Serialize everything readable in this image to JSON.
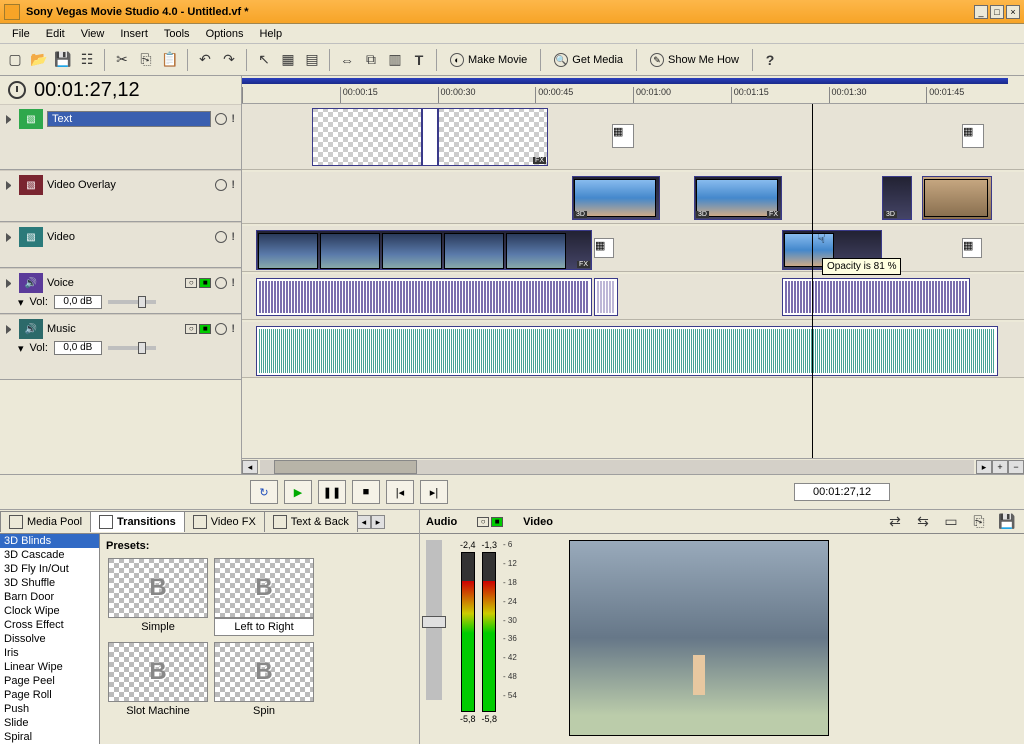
{
  "window": {
    "title": "Sony Vegas Movie Studio 4.0 - Untitled.vf *"
  },
  "menu": [
    "File",
    "Edit",
    "View",
    "Insert",
    "Tools",
    "Options",
    "Help"
  ],
  "toolbar": {
    "make_movie": "Make Movie",
    "get_media": "Get Media",
    "show_me_how": "Show Me How"
  },
  "timecode": "00:01:27,12",
  "tracks": [
    {
      "name": "Text",
      "color": "green",
      "selected": true
    },
    {
      "name": "Video Overlay",
      "color": "maroon"
    },
    {
      "name": "Video",
      "color": "teal"
    },
    {
      "name": "Voice",
      "color": "purple",
      "vol_label": "Vol:",
      "vol_value": "0,0 dB"
    },
    {
      "name": "Music",
      "color": "darkteal",
      "vol_label": "Vol:",
      "vol_value": "0,0 dB"
    }
  ],
  "ruler_ticks": [
    "",
    "00:00:15",
    "00:00:30",
    "00:00:45",
    "00:01:00",
    "00:01:15",
    "00:01:30",
    "00:01:45"
  ],
  "tooltip": "Opacity is 81 %",
  "transport_time": "00:01:27,12",
  "tabs": {
    "media_pool": "Media Pool",
    "transitions": "Transitions",
    "video_fx": "Video FX",
    "text_back": "Text & Back"
  },
  "presets_header": "Presets:",
  "transition_list": [
    "3D Blinds",
    "3D Cascade",
    "3D Fly In/Out",
    "3D Shuffle",
    "Barn Door",
    "Clock Wipe",
    "Cross Effect",
    "Dissolve",
    "Iris",
    "Linear Wipe",
    "Page Peel",
    "Page Roll",
    "Push",
    "Slide",
    "Spiral"
  ],
  "transition_selected": "3D Blinds",
  "presets": [
    "Simple",
    "Left to Right",
    "Slot Machine",
    "Spin"
  ],
  "preset_selected": "Left to Right",
  "preview": {
    "audio_label": "Audio",
    "video_label": "Video",
    "meter_top": [
      "-2,4",
      "-1,3"
    ],
    "meter_bottom": [
      "-5,8",
      "-5,8"
    ],
    "scale": [
      "6",
      "12",
      "18",
      "24",
      "30",
      "36",
      "42",
      "48",
      "54"
    ]
  }
}
